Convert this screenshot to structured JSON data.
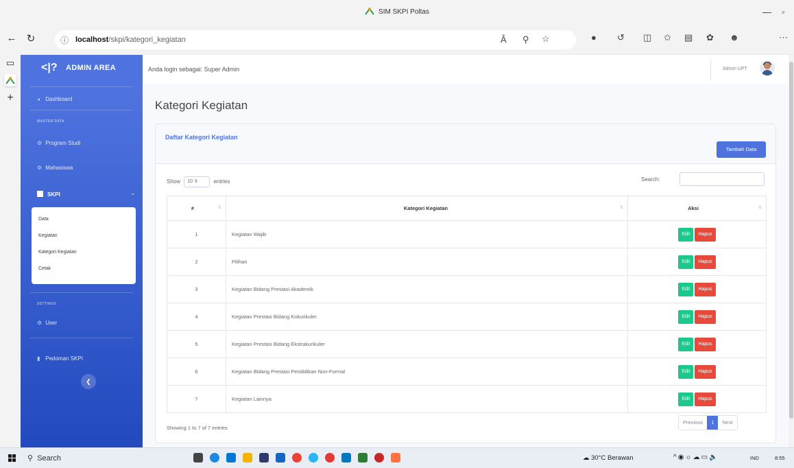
{
  "browser": {
    "window_title": "SIM SKPI Poltas",
    "url_host": "localhost",
    "url_path": "/skpi/kategori_kegiatan",
    "icons": [
      "back-icon",
      "refresh-icon",
      "info-icon",
      "read-aloud-icon",
      "zoom-icon",
      "favorite-icon",
      "extension-icon",
      "split-screen-icon",
      "favorites-bar-icon",
      "collections-icon",
      "profile-icon",
      "more-icon"
    ]
  },
  "sidebar": {
    "brand_mark": "<|?",
    "brand": "ADMIN AREA",
    "dashboard": "Dashboard",
    "heading_master": "MASTER DATA",
    "program_studi": "Program Studi",
    "mahasiswa": "Mahasiswa",
    "skpi": "SKPI",
    "submenu": [
      "Data",
      "Kegiatan",
      "Kategori Kegiatan",
      "Cetak"
    ],
    "heading_settings": "SETTINGS",
    "user": "User",
    "pedoman": "Pedoman SKPI"
  },
  "topbar": {
    "login_text": "Anda login sebagai: Super Admin",
    "user_name": "Admin UPT"
  },
  "page": {
    "title": "Kategori Kegiatan",
    "card_title": "Daftar Kategori Kegiatan",
    "add_button": "Tambah Data",
    "show_label": "Show",
    "entries_label": "entries",
    "length_value": "10",
    "search_label": "Search:",
    "columns": [
      "#",
      "Kategori Kegiatan",
      "Aksi"
    ],
    "rows": [
      {
        "no": "1",
        "kategori": "Kegiatan Wajib"
      },
      {
        "no": "2",
        "kategori": "Pilihan"
      },
      {
        "no": "3",
        "kategori": "Kegiatan Bidang Prestasi Akademik"
      },
      {
        "no": "4",
        "kategori": "Kegiatan Prestasi Bidang Kokurikuler"
      },
      {
        "no": "5",
        "kategori": "Kegiatan Prestasi Bidang Ekstrakurikuler"
      },
      {
        "no": "6",
        "kategori": "Kegiatan Bidang Prestasi Pendidikan Non-Formal"
      },
      {
        "no": "7",
        "kategori": "Kegiatan Lainnya"
      }
    ],
    "edit_label": "Edit",
    "delete_label": "Hapus",
    "info": "Showing 1 to 7 of 7 entries",
    "prev": "Previous",
    "current_page": "1",
    "next": "Next"
  },
  "taskbar": {
    "search": "Search",
    "weather": "30°C Berawan",
    "lang": "IND",
    "time": "8:55"
  },
  "colors": {
    "primary": "#4e73df",
    "success": "#1cc88a",
    "danger": "#e74a3b"
  }
}
